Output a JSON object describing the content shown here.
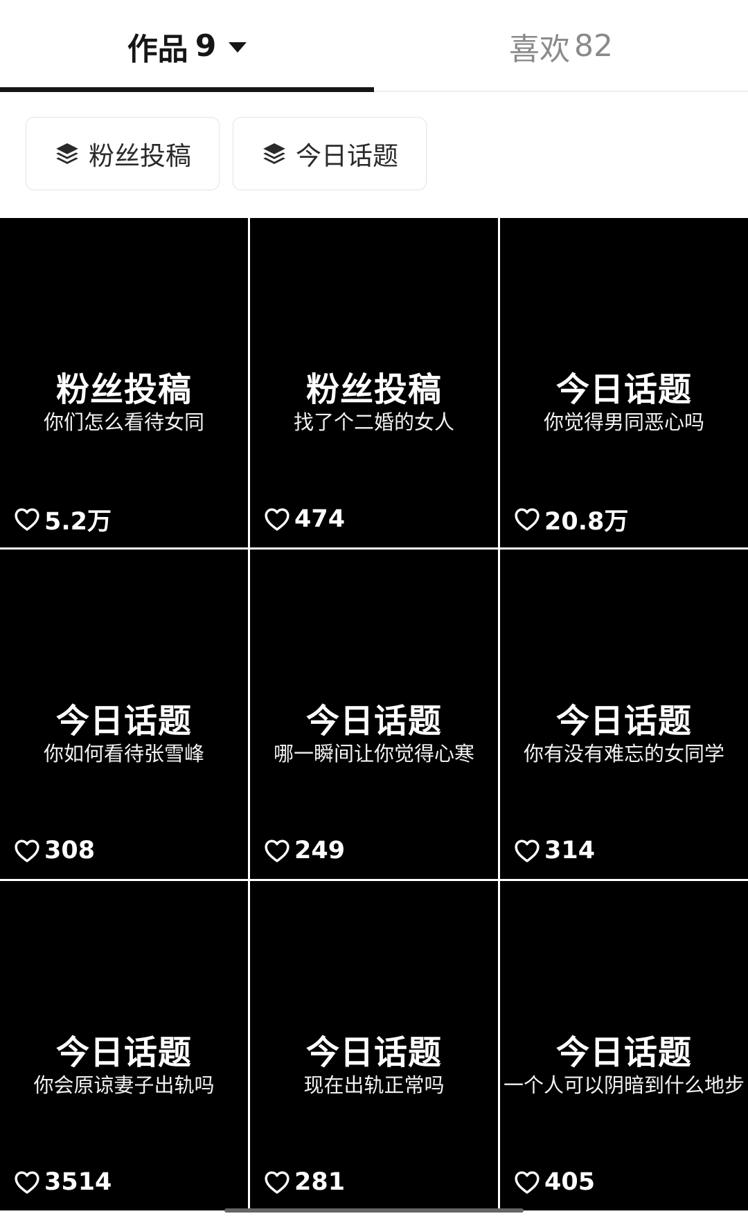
{
  "tabs": {
    "works": {
      "label": "作品",
      "count": "9"
    },
    "likes": {
      "label": "喜欢",
      "count": "82"
    }
  },
  "chips": [
    {
      "label": "粉丝投稿",
      "icon": "layers-icon"
    },
    {
      "label": "今日话题",
      "icon": "layers-icon"
    }
  ],
  "videos": [
    {
      "title": "粉丝投稿",
      "subtitle": "你们怎么看待女同",
      "likes": "5.2万"
    },
    {
      "title": "粉丝投稿",
      "subtitle": "找了个二婚的女人",
      "likes": "474"
    },
    {
      "title": "今日话题",
      "subtitle": "你觉得男同恶心吗",
      "likes": "20.8万"
    },
    {
      "title": "今日话题",
      "subtitle": "你如何看待张雪峰",
      "likes": "308"
    },
    {
      "title": "今日话题",
      "subtitle": "哪一瞬间让你觉得心寒",
      "likes": "249"
    },
    {
      "title": "今日话题",
      "subtitle": "你有没有难忘的女同学",
      "likes": "314"
    },
    {
      "title": "今日话题",
      "subtitle": "你会原谅妻子出轨吗",
      "likes": "3514"
    },
    {
      "title": "今日话题",
      "subtitle": "现在出轨正常吗",
      "likes": "281"
    },
    {
      "title": "今日话题",
      "subtitle": "一个人可以阴暗到什么地步",
      "likes": "405"
    }
  ],
  "colors": {
    "background": "#ffffff",
    "tile": "#000000",
    "active_text": "#161616",
    "inactive_text": "#8a8a8a"
  }
}
